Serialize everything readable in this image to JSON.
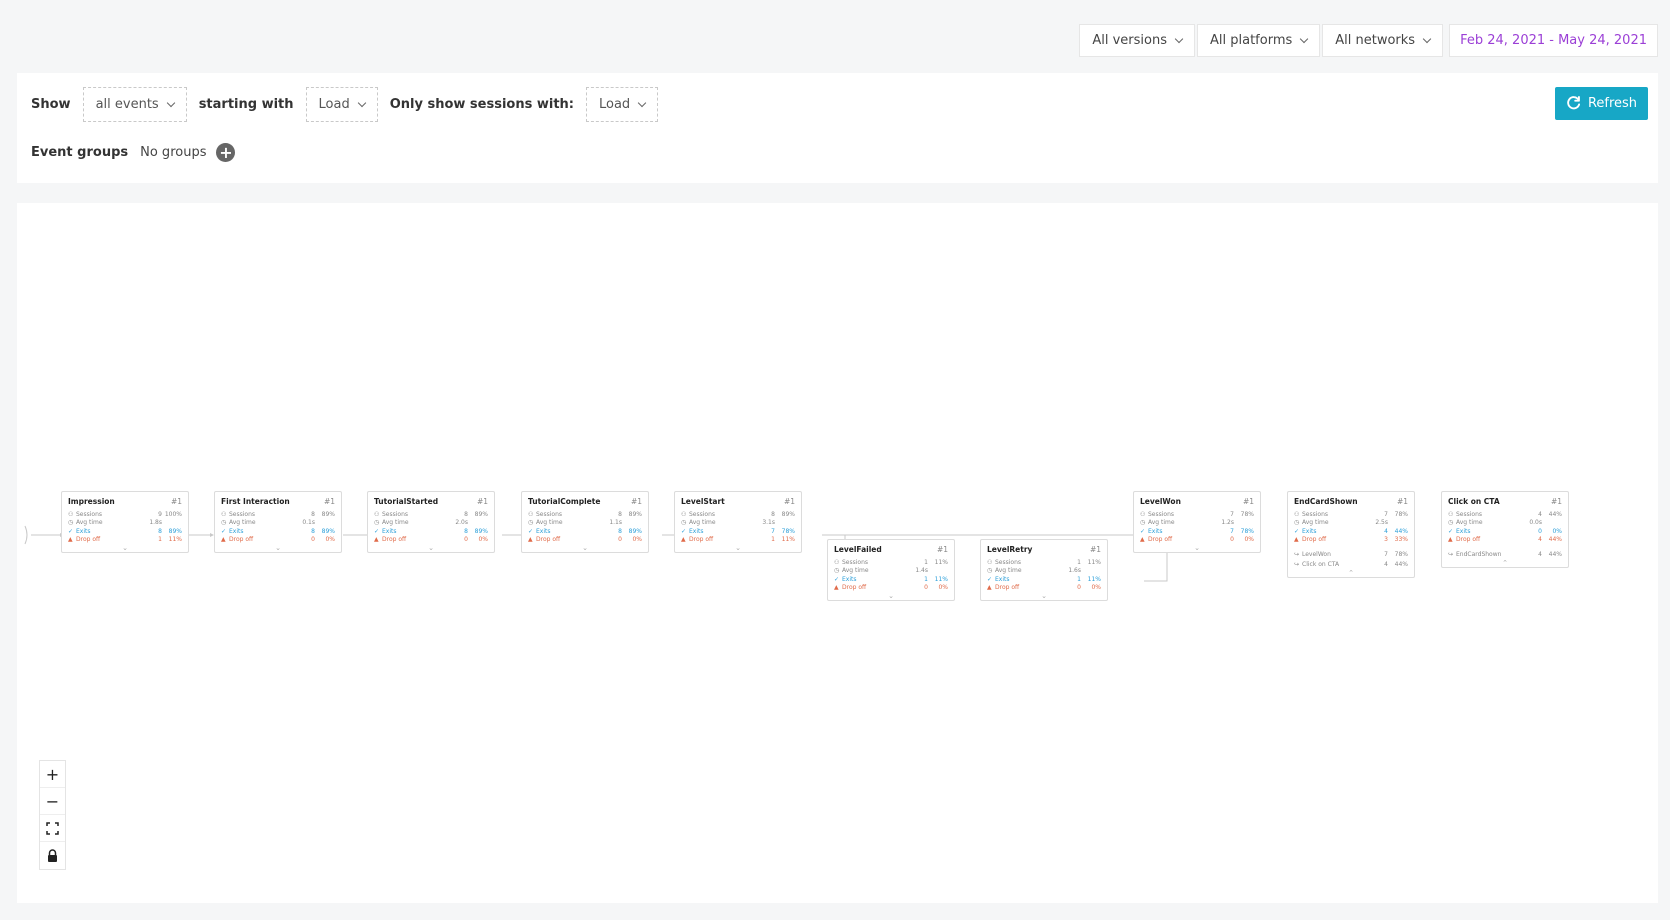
{
  "filters": {
    "versions": "All versions",
    "platforms": "All platforms",
    "networks": "All networks",
    "date_range": "Feb 24, 2021 - May 24, 2021"
  },
  "controls": {
    "show_label": "Show",
    "show_value": "all events",
    "starting_label": "starting with",
    "starting_value": "Load",
    "only_label": "Only show sessions with:",
    "only_value": "Load",
    "refresh_label": "Refresh",
    "groups_label": "Event groups",
    "groups_value": "No groups"
  },
  "row_labels": {
    "sessions": "Sessions",
    "avg": "Avg time",
    "exits": "Exits",
    "drop": "Drop off"
  },
  "nodes": [
    {
      "name": "Impression",
      "rank": "#1",
      "sessions": "9",
      "sessions_pct": "100%",
      "avg": "1.8s",
      "exits": "8",
      "exits_pct": "89%",
      "drop": "1",
      "drop_pct": "11%"
    },
    {
      "name": "First Interaction",
      "rank": "#1",
      "sessions": "8",
      "sessions_pct": "89%",
      "avg": "0.1s",
      "exits": "8",
      "exits_pct": "89%",
      "drop": "0",
      "drop_pct": "0%"
    },
    {
      "name": "TutorialStarted",
      "rank": "#1",
      "sessions": "8",
      "sessions_pct": "89%",
      "avg": "2.0s",
      "exits": "8",
      "exits_pct": "89%",
      "drop": "0",
      "drop_pct": "0%"
    },
    {
      "name": "TutorialComplete",
      "rank": "#1",
      "sessions": "8",
      "sessions_pct": "89%",
      "avg": "1.1s",
      "exits": "8",
      "exits_pct": "89%",
      "drop": "0",
      "drop_pct": "0%"
    },
    {
      "name": "LevelStart",
      "rank": "#1",
      "sessions": "8",
      "sessions_pct": "89%",
      "avg": "3.1s",
      "exits": "7",
      "exits_pct": "78%",
      "drop": "1",
      "drop_pct": "11%"
    },
    {
      "name": "LevelFailed",
      "rank": "#1",
      "sessions": "1",
      "sessions_pct": "11%",
      "avg": "1.4s",
      "exits": "1",
      "exits_pct": "11%",
      "drop": "0",
      "drop_pct": "0%"
    },
    {
      "name": "LevelRetry",
      "rank": "#1",
      "sessions": "1",
      "sessions_pct": "11%",
      "avg": "1.6s",
      "exits": "1",
      "exits_pct": "11%",
      "drop": "0",
      "drop_pct": "0%"
    },
    {
      "name": "LevelWon",
      "rank": "#1",
      "sessions": "7",
      "sessions_pct": "78%",
      "avg": "1.2s",
      "exits": "7",
      "exits_pct": "78%",
      "drop": "0",
      "drop_pct": "0%"
    },
    {
      "name": "EndCardShown",
      "rank": "#1",
      "sessions": "7",
      "sessions_pct": "78%",
      "avg": "2.5s",
      "exits": "4",
      "exits_pct": "44%",
      "drop": "3",
      "drop_pct": "33%",
      "next": [
        {
          "label": "LevelWon",
          "count": "7",
          "pct": "78%"
        },
        {
          "label": "Click on CTA",
          "count": "4",
          "pct": "44%"
        }
      ]
    },
    {
      "name": "Click on CTA",
      "rank": "#1",
      "sessions": "4",
      "sessions_pct": "44%",
      "avg": "0.0s",
      "exits": "0",
      "exits_pct": "0%",
      "drop": "4",
      "drop_pct": "44%",
      "next": [
        {
          "label": "EndCardShown",
          "count": "4",
          "pct": "44%"
        }
      ]
    }
  ],
  "zoom": {
    "in": "+",
    "out": "−"
  }
}
